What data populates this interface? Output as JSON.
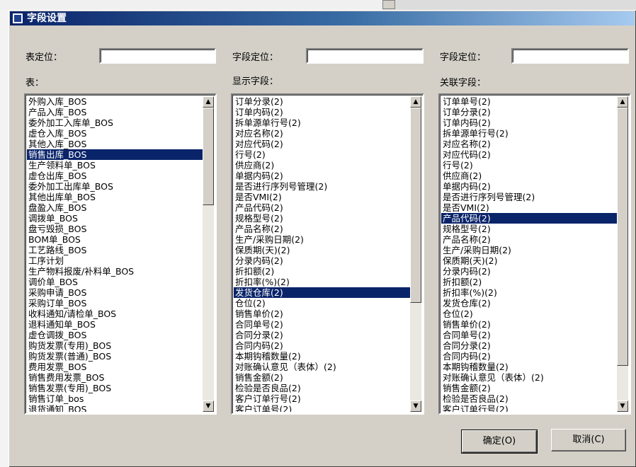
{
  "dialog": {
    "title": "字段设置"
  },
  "panels": [
    {
      "locate_label": "表定位：",
      "locate_value": "",
      "list_label": "表：",
      "items": [
        "外购入库_BOS",
        "产品入库_BOS",
        "委外加工入库单_BOS",
        "虚仓入库_BOS",
        "其他入库_BOS",
        "销售出库_BOS",
        "生产领料单_BOS",
        "虚仓出库_BOS",
        "委外加工出库单_BOS",
        "其他出库单_BOS",
        "盘盈入库_BOS",
        "调拨单_BOS",
        "盘亏毁损_BOS",
        "BOM单_BOS",
        "工艺路线_BOS",
        "工序计划",
        "生产物料报废/补料单_BOS",
        "调价单_BOS",
        "采购申请_BOS",
        "采购订单_BOS",
        "收料通知/请检单_BOS",
        "退料通知单_BOS",
        "虚仓调拨_BOS",
        "购货发票(专用)_BOS",
        "购货发票(普通)_BOS",
        "费用发票_BOS",
        "销售费用发票_BOS",
        "销售发票(专用)_BOS",
        "销售订单_bos",
        "退货通知_BOS"
      ],
      "selected": 5
    },
    {
      "locate_label": "字段定位：",
      "locate_value": "",
      "list_label": "显示字段：",
      "items": [
        "订单分录(2)",
        "订单内码(2)",
        "拆单源单行号(2)",
        "对应名称(2)",
        "对应代码(2)",
        "行号(2)",
        "供应商(2)",
        "单据内码(2)",
        "是否进行序列号管理(2)",
        "是否VMI(2)",
        "产品代码(2)",
        "规格型号(2)",
        "产品名称(2)",
        "生产/采购日期(2)",
        "保质期(天)(2)",
        "分录内码(2)",
        "折扣额(2)",
        "折扣率(%)(2)",
        "发货仓库(2)",
        "仓位(2)",
        "销售单价(2)",
        "合同单号(2)",
        "合同分录(2)",
        "合同内码(2)",
        "本期钩稽数量(2)",
        "对账确认意见（表体）(2)",
        "销售金额(2)",
        "检验是否良品(2)",
        "客户订单行号(2)",
        "客户订单号(2)"
      ],
      "selected": 18
    },
    {
      "locate_label": "字段定位：",
      "locate_value": "",
      "list_label": "关联字段：",
      "items": [
        "订单单号(2)",
        "订单分录(2)",
        "订单内码(2)",
        "拆单源单行号(2)",
        "对应名称(2)",
        "对应代码(2)",
        "行号(2)",
        "供应商(2)",
        "单据内码(2)",
        "是否进行序列号管理(2)",
        "是否VMI(2)",
        "产品代码(2)",
        "规格型号(2)",
        "产品名称(2)",
        "生产/采购日期(2)",
        "保质期(天)(2)",
        "分录内码(2)",
        "折扣额(2)",
        "折扣率(%)(2)",
        "发货仓库(2)",
        "仓位(2)",
        "销售单价(2)",
        "合同单号(2)",
        "合同分录(2)",
        "合同内码(2)",
        "本期钩稽数量(2)",
        "对账确认意见（表体）(2)",
        "销售金额(2)",
        "检验是否良品(2)",
        "客户订单行号(2)"
      ],
      "selected": 11
    }
  ],
  "buttons": {
    "ok": "确定(O)",
    "cancel": "取消(C)"
  },
  "icons": {
    "title": "app-logo-icon",
    "scroll_up": "triangle-up-icon",
    "scroll_down": "triangle-down-icon"
  },
  "scroll": [
    {
      "first": 0,
      "visible": 30,
      "total": 90
    },
    {
      "first": 0,
      "visible": 30,
      "total": 45
    },
    {
      "first": 0,
      "visible": 30,
      "total": 34
    }
  ],
  "colors": {
    "selection": "#0a246a",
    "title_start": "#0a246a",
    "title_end": "#a6caf0",
    "face": "#d4d0c8"
  }
}
